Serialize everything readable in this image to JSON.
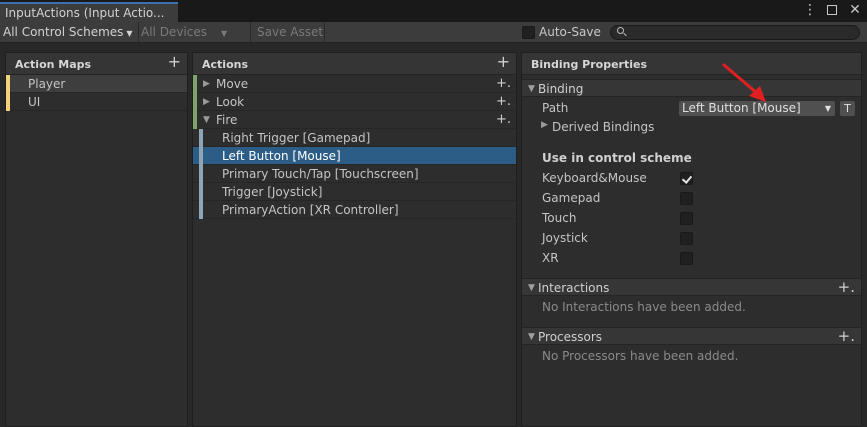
{
  "window": {
    "tab_title": "InputActions (Input Actio...",
    "icons": [
      "kebab-icon",
      "maximize-icon",
      "close-icon"
    ]
  },
  "toolbar": {
    "control_schemes": "All Control Schemes",
    "devices": "All Devices",
    "save_asset": "Save Asset",
    "auto_save": "Auto-Save",
    "search_placeholder": ""
  },
  "action_maps": {
    "title": "Action Maps",
    "items": [
      {
        "label": "Player",
        "selected": true
      },
      {
        "label": "UI",
        "selected": false
      }
    ],
    "bar_color": "#f4d27a"
  },
  "actions": {
    "title": "Actions",
    "items": [
      {
        "label": "Move",
        "expanded": false
      },
      {
        "label": "Look",
        "expanded": false
      },
      {
        "label": "Fire",
        "expanded": true
      }
    ],
    "bindings": [
      {
        "label": "Right Trigger [Gamepad]",
        "selected": false
      },
      {
        "label": "Left Button [Mouse]",
        "selected": true
      },
      {
        "label": "Primary Touch/Tap [Touchscreen]",
        "selected": false
      },
      {
        "label": "Trigger [Joystick]",
        "selected": false
      },
      {
        "label": "PrimaryAction [XR Controller]",
        "selected": false
      }
    ],
    "bar_color": "#7ea46a"
  },
  "properties": {
    "title": "Binding Properties",
    "binding_section": "Binding",
    "path_label": "Path",
    "path_value": "Left Button [Mouse]",
    "t_button": "T",
    "derived_bindings": "Derived Bindings",
    "scheme_heading": "Use in control scheme",
    "schemes": [
      {
        "label": "Keyboard&Mouse",
        "checked": true
      },
      {
        "label": "Gamepad",
        "checked": false
      },
      {
        "label": "Touch",
        "checked": false
      },
      {
        "label": "Joystick",
        "checked": false
      },
      {
        "label": "XR",
        "checked": false
      }
    ],
    "interactions_section": "Interactions",
    "interactions_empty": "No Interactions have been added.",
    "processors_section": "Processors",
    "processors_empty": "No Processors have been added."
  },
  "annotation": {
    "arrow_color": "#e02020"
  },
  "colors": {
    "selection": "#2c5d87",
    "panel_bg": "#2d2d2d"
  }
}
